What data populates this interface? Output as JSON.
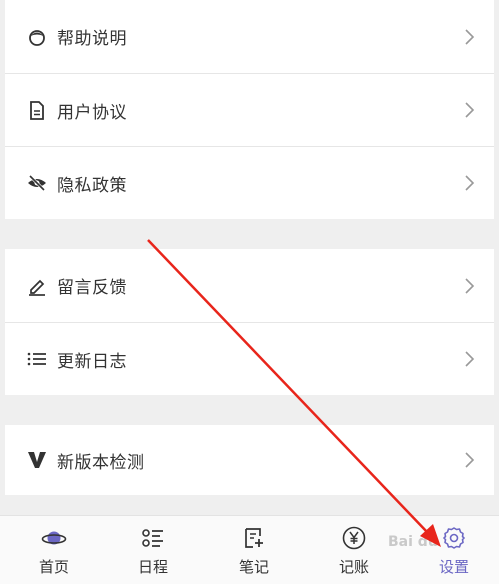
{
  "menu_group_1": [
    {
      "label": "帮助说明",
      "icon": "help-icon"
    },
    {
      "label": "用户协议",
      "icon": "document-icon"
    },
    {
      "label": "隐私政策",
      "icon": "eye-off-icon"
    }
  ],
  "menu_group_2": [
    {
      "label": "留言反馈",
      "icon": "pencil-icon"
    },
    {
      "label": "更新日志",
      "icon": "list-icon"
    }
  ],
  "menu_group_3": [
    {
      "label": "新版本检测",
      "icon": "version-v-icon"
    }
  ],
  "tabbar": {
    "tabs": [
      {
        "label": "首页",
        "icon": "planet-icon"
      },
      {
        "label": "日程",
        "icon": "schedule-icon"
      },
      {
        "label": "笔记",
        "icon": "note-icon"
      },
      {
        "label": "记账",
        "icon": "yuan-icon"
      },
      {
        "label": "设置",
        "icon": "gear-icon",
        "active": true
      }
    ]
  },
  "watermark": "Bai du",
  "colors": {
    "accent": "#6b67c4",
    "annotation_arrow": "#e8251b"
  }
}
